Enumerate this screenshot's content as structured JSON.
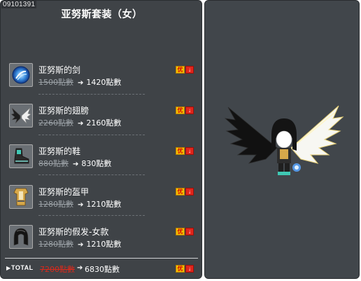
{
  "item_id": "09101391",
  "title": "亚努斯套装（女）",
  "items": [
    {
      "name": "亚努斯的剑",
      "old_price": "1500點數",
      "new_price": "1420點數",
      "icon": "sword-orb-icon"
    },
    {
      "name": "亚努斯的翅膀",
      "old_price": "2260點數",
      "new_price": "2160點數",
      "icon": "wings-icon"
    },
    {
      "name": "亚努斯的鞋",
      "old_price": "880點數",
      "new_price": "830點數",
      "icon": "shoes-icon"
    },
    {
      "name": "亚努斯的盔甲",
      "old_price": "1280點數",
      "new_price": "1210點數",
      "icon": "armor-icon"
    },
    {
      "name": "亚努斯的假发-女款",
      "old_price": "1280點數",
      "new_price": "1210點數",
      "icon": "wig-icon"
    }
  ],
  "total": {
    "label": "TOTAL",
    "old_price": "7200點數",
    "new_price": "6830點數"
  },
  "badge": {
    "left_text": "优",
    "right_text": "↓"
  },
  "colors": {
    "panel": "#3f4347",
    "badge_yellow": "#f2c200",
    "badge_red": "#e0261c",
    "total_old": "#d92a1c"
  }
}
